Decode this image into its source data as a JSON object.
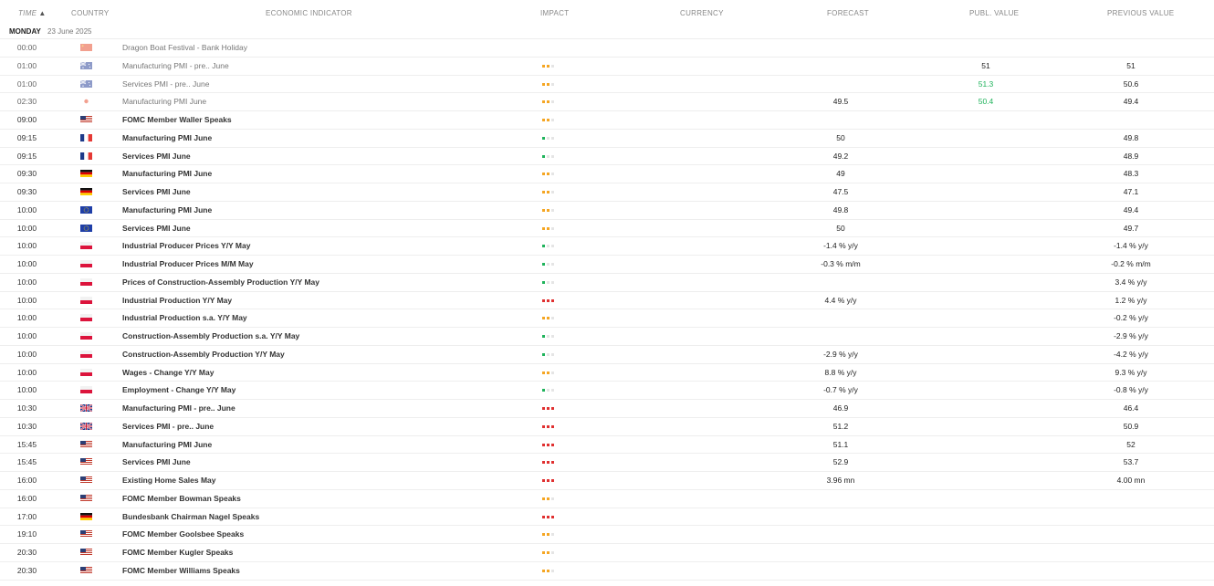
{
  "header": {
    "time": "TIME",
    "country": "COUNTRY",
    "indicator": "ECONOMIC INDICATOR",
    "impact": "IMPACT",
    "currency": "CURRENCY",
    "forecast": "FORECAST",
    "publ_value": "PUBL. VALUE",
    "previous": "PREVIOUS VALUE"
  },
  "day": {
    "name": "MONDAY",
    "date": "23 June 2025"
  },
  "colors": {
    "green": "#1fb35b",
    "orange": "#f5a623",
    "red": "#e03030",
    "grey": "#e5e5e5"
  },
  "rows": [
    {
      "time": "00:00",
      "country": "cn",
      "indicator": "Dragon Boat Festival - Bank Holiday",
      "impact": 0,
      "impact_color": "",
      "forecast": "",
      "publ": "",
      "publ_color": "",
      "prev": "",
      "past": true
    },
    {
      "time": "01:00",
      "country": "au",
      "indicator": "Manufacturing PMI - pre.. June",
      "impact": 2,
      "impact_color": "orange",
      "forecast": "",
      "publ": "51",
      "publ_color": "",
      "prev": "51",
      "past": true
    },
    {
      "time": "01:00",
      "country": "au",
      "indicator": "Services PMI - pre.. June",
      "impact": 2,
      "impact_color": "orange",
      "forecast": "",
      "publ": "51.3",
      "publ_color": "green",
      "prev": "50.6",
      "past": true
    },
    {
      "time": "02:30",
      "country": "jp",
      "indicator": "Manufacturing PMI June",
      "impact": 2,
      "impact_color": "orange",
      "forecast": "49.5",
      "publ": "50.4",
      "publ_color": "green",
      "prev": "49.4",
      "past": true
    },
    {
      "time": "09:00",
      "country": "us",
      "indicator": "FOMC Member Waller Speaks",
      "impact": 2,
      "impact_color": "orange",
      "forecast": "",
      "publ": "",
      "publ_color": "",
      "prev": "",
      "past": false
    },
    {
      "time": "09:15",
      "country": "fr",
      "indicator": "Manufacturing PMI June",
      "impact": 1,
      "impact_color": "green",
      "forecast": "50",
      "publ": "",
      "publ_color": "",
      "prev": "49.8",
      "past": false
    },
    {
      "time": "09:15",
      "country": "fr",
      "indicator": "Services PMI June",
      "impact": 1,
      "impact_color": "green",
      "forecast": "49.2",
      "publ": "",
      "publ_color": "",
      "prev": "48.9",
      "past": false
    },
    {
      "time": "09:30",
      "country": "de",
      "indicator": "Manufacturing PMI June",
      "impact": 2,
      "impact_color": "orange",
      "forecast": "49",
      "publ": "",
      "publ_color": "",
      "prev": "48.3",
      "past": false
    },
    {
      "time": "09:30",
      "country": "de",
      "indicator": "Services PMI June",
      "impact": 2,
      "impact_color": "orange",
      "forecast": "47.5",
      "publ": "",
      "publ_color": "",
      "prev": "47.1",
      "past": false
    },
    {
      "time": "10:00",
      "country": "eu",
      "indicator": "Manufacturing PMI June",
      "impact": 2,
      "impact_color": "orange",
      "forecast": "49.8",
      "publ": "",
      "publ_color": "",
      "prev": "49.4",
      "past": false
    },
    {
      "time": "10:00",
      "country": "eu",
      "indicator": "Services PMI June",
      "impact": 2,
      "impact_color": "orange",
      "forecast": "50",
      "publ": "",
      "publ_color": "",
      "prev": "49.7",
      "past": false
    },
    {
      "time": "10:00",
      "country": "pl",
      "indicator": "Industrial Producer Prices Y/Y May",
      "impact": 1,
      "impact_color": "green",
      "forecast": "-1.4 % y/y",
      "publ": "",
      "publ_color": "",
      "prev": "-1.4 % y/y",
      "past": false
    },
    {
      "time": "10:00",
      "country": "pl",
      "indicator": "Industrial Producer Prices M/M May",
      "impact": 1,
      "impact_color": "green",
      "forecast": "-0.3 % m/m",
      "publ": "",
      "publ_color": "",
      "prev": "-0.2 % m/m",
      "past": false
    },
    {
      "time": "10:00",
      "country": "pl",
      "indicator": "Prices of Construction-Assembly Production Y/Y May",
      "impact": 1,
      "impact_color": "green",
      "forecast": "",
      "publ": "",
      "publ_color": "",
      "prev": "3.4 % y/y",
      "past": false
    },
    {
      "time": "10:00",
      "country": "pl",
      "indicator": "Industrial Production Y/Y May",
      "impact": 3,
      "impact_color": "red",
      "forecast": "4.4 % y/y",
      "publ": "",
      "publ_color": "",
      "prev": "1.2 % y/y",
      "past": false
    },
    {
      "time": "10:00",
      "country": "pl",
      "indicator": "Industrial Production s.a. Y/Y May",
      "impact": 2,
      "impact_color": "orange",
      "forecast": "",
      "publ": "",
      "publ_color": "",
      "prev": "-0.2 % y/y",
      "past": false
    },
    {
      "time": "10:00",
      "country": "pl",
      "indicator": "Construction-Assembly Production s.a. Y/Y May",
      "impact": 1,
      "impact_color": "green",
      "forecast": "",
      "publ": "",
      "publ_color": "",
      "prev": "-2.9 % y/y",
      "past": false
    },
    {
      "time": "10:00",
      "country": "pl",
      "indicator": "Construction-Assembly Production Y/Y May",
      "impact": 1,
      "impact_color": "green",
      "forecast": "-2.9 % y/y",
      "publ": "",
      "publ_color": "",
      "prev": "-4.2 % y/y",
      "past": false
    },
    {
      "time": "10:00",
      "country": "pl",
      "indicator": "Wages - Change Y/Y May",
      "impact": 2,
      "impact_color": "orange",
      "forecast": "8.8 % y/y",
      "publ": "",
      "publ_color": "",
      "prev": "9.3 % y/y",
      "past": false
    },
    {
      "time": "10:00",
      "country": "pl",
      "indicator": "Employment - Change Y/Y May",
      "impact": 1,
      "impact_color": "green",
      "forecast": "-0.7 % y/y",
      "publ": "",
      "publ_color": "",
      "prev": "-0.8 % y/y",
      "past": false
    },
    {
      "time": "10:30",
      "country": "gb",
      "indicator": "Manufacturing PMI - pre.. June",
      "impact": 3,
      "impact_color": "red",
      "forecast": "46.9",
      "publ": "",
      "publ_color": "",
      "prev": "46.4",
      "past": false
    },
    {
      "time": "10:30",
      "country": "gb",
      "indicator": "Services PMI - pre.. June",
      "impact": 3,
      "impact_color": "red",
      "forecast": "51.2",
      "publ": "",
      "publ_color": "",
      "prev": "50.9",
      "past": false
    },
    {
      "time": "15:45",
      "country": "us",
      "indicator": "Manufacturing PMI June",
      "impact": 3,
      "impact_color": "red",
      "forecast": "51.1",
      "publ": "",
      "publ_color": "",
      "prev": "52",
      "past": false
    },
    {
      "time": "15:45",
      "country": "us",
      "indicator": "Services PMI June",
      "impact": 3,
      "impact_color": "red",
      "forecast": "52.9",
      "publ": "",
      "publ_color": "",
      "prev": "53.7",
      "past": false
    },
    {
      "time": "16:00",
      "country": "us",
      "indicator": "Existing Home Sales May",
      "impact": 3,
      "impact_color": "red",
      "forecast": "3.96 mn",
      "publ": "",
      "publ_color": "",
      "prev": "4.00 mn",
      "past": false
    },
    {
      "time": "16:00",
      "country": "us",
      "indicator": "FOMC Member Bowman Speaks",
      "impact": 2,
      "impact_color": "orange",
      "forecast": "",
      "publ": "",
      "publ_color": "",
      "prev": "",
      "past": false
    },
    {
      "time": "17:00",
      "country": "de",
      "indicator": "Bundesbank Chairman Nagel Speaks",
      "impact": 3,
      "impact_color": "red",
      "forecast": "",
      "publ": "",
      "publ_color": "",
      "prev": "",
      "past": false
    },
    {
      "time": "19:10",
      "country": "us",
      "indicator": "FOMC Member Goolsbee Speaks",
      "impact": 2,
      "impact_color": "orange",
      "forecast": "",
      "publ": "",
      "publ_color": "",
      "prev": "",
      "past": false
    },
    {
      "time": "20:30",
      "country": "us",
      "indicator": "FOMC Member Kugler Speaks",
      "impact": 2,
      "impact_color": "orange",
      "forecast": "",
      "publ": "",
      "publ_color": "",
      "prev": "",
      "past": false
    },
    {
      "time": "20:30",
      "country": "us",
      "indicator": "FOMC Member Williams Speaks",
      "impact": 2,
      "impact_color": "orange",
      "forecast": "",
      "publ": "",
      "publ_color": "",
      "prev": "",
      "past": false
    }
  ]
}
